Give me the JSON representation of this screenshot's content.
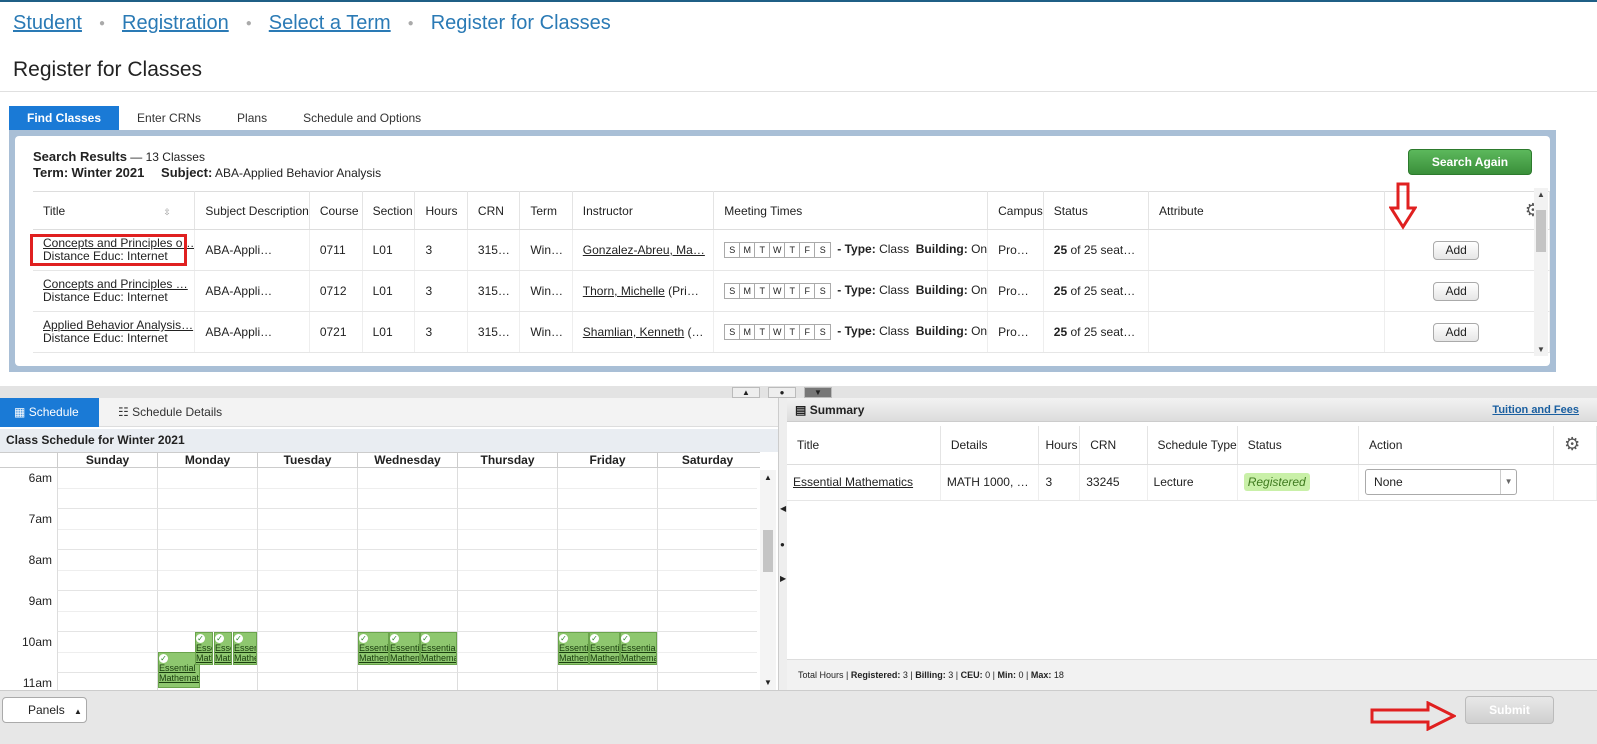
{
  "breadcrumb": {
    "items": [
      "Student",
      "Registration",
      "Select a Term"
    ],
    "current": "Register for Classes"
  },
  "page_title": "Register for Classes",
  "tabs": [
    "Find Classes",
    "Enter CRNs",
    "Plans",
    "Schedule and Options"
  ],
  "search": {
    "heading": "Search Results",
    "count": "— 13 Classes",
    "term_label": "Term:",
    "term_value": "Winter 2021",
    "subject_label": "Subject:",
    "subject_value": "ABA-Applied Behavior Analysis",
    "search_again": "Search Again"
  },
  "results": {
    "columns": [
      "Title",
      "Subject Description",
      "Course",
      "Section",
      "Hours",
      "CRN",
      "Term",
      "Instructor",
      "Meeting Times",
      "Campus",
      "Status",
      "Attribute"
    ],
    "days": [
      "S",
      "M",
      "T",
      "W",
      "T",
      "F",
      "S"
    ],
    "type_label": "- Type:",
    "type_value": "Class",
    "building_label": "Building:",
    "building_value": "On",
    "add_label": "Add",
    "rows": [
      {
        "title": "Concepts and Principles o…",
        "mode": "Distance Educ: Internet",
        "subject": "ABA-Appli…",
        "course": "0711",
        "section": "L01",
        "hours": "3",
        "crn": "315…",
        "term": "Win…",
        "instructor": "Gonzalez-Abreu, Ma…",
        "instructor_extra": "",
        "campus": "Pro…",
        "seats": "25",
        "seats_text": "of 25 seat…"
      },
      {
        "title": "Concepts and Principles …",
        "mode": "Distance Educ: Internet",
        "subject": "ABA-Appli…",
        "course": "0712",
        "section": "L01",
        "hours": "3",
        "crn": "315…",
        "term": "Win…",
        "instructor": "Thorn, Michelle",
        "instructor_extra": "(Pri…",
        "campus": "Pro…",
        "seats": "25",
        "seats_text": "of 25 seat…"
      },
      {
        "title": "Applied Behavior Analysis…",
        "mode": "Distance Educ: Internet",
        "subject": "ABA-Appli…",
        "course": "0721",
        "section": "L01",
        "hours": "3",
        "crn": "315…",
        "term": "Win…",
        "instructor": "Shamlian, Kenneth",
        "instructor_extra": "(…",
        "campus": "Pro…",
        "seats": "25",
        "seats_text": "of 25 seat…"
      }
    ]
  },
  "schedule": {
    "tab_schedule": "Schedule",
    "tab_details": "Schedule Details",
    "title": "Class Schedule for Winter 2021",
    "days": [
      "Sunday",
      "Monday",
      "Tuesday",
      "Wednesday",
      "Thursday",
      "Friday",
      "Saturday"
    ],
    "hours": [
      "6am",
      "7am",
      "8am",
      "9am",
      "10am",
      "11am"
    ],
    "event_text": "Essential Mathematics"
  },
  "summary": {
    "title": "Summary",
    "tuition_link": "Tuition and Fees",
    "columns": [
      "Title",
      "Details",
      "Hours",
      "CRN",
      "Schedule Type",
      "Status",
      "Action"
    ],
    "row": {
      "title": "Essential Mathematics",
      "details": "MATH 1000, …",
      "hours": "3",
      "crn": "33245",
      "schedule_type": "Lecture",
      "status": "Registered",
      "action": "None"
    },
    "footer": {
      "prefix": "Total Hours |",
      "registered_label": "Registered:",
      "registered": "3",
      "billing_label": "Billing:",
      "billing": "3",
      "ceu_label": "CEU:",
      "ceu": "0",
      "min_label": "Min:",
      "min": "0",
      "max_label": "Max:",
      "max": "18"
    }
  },
  "footer": {
    "panels": "Panels",
    "submit": "Submit"
  },
  "colors": {
    "primary_tab": "#1a7ad6",
    "search_again": "#4cae4c",
    "registered_badge": "#c9f0a8",
    "event": "#8ec76f",
    "annotation": "#e02020"
  }
}
